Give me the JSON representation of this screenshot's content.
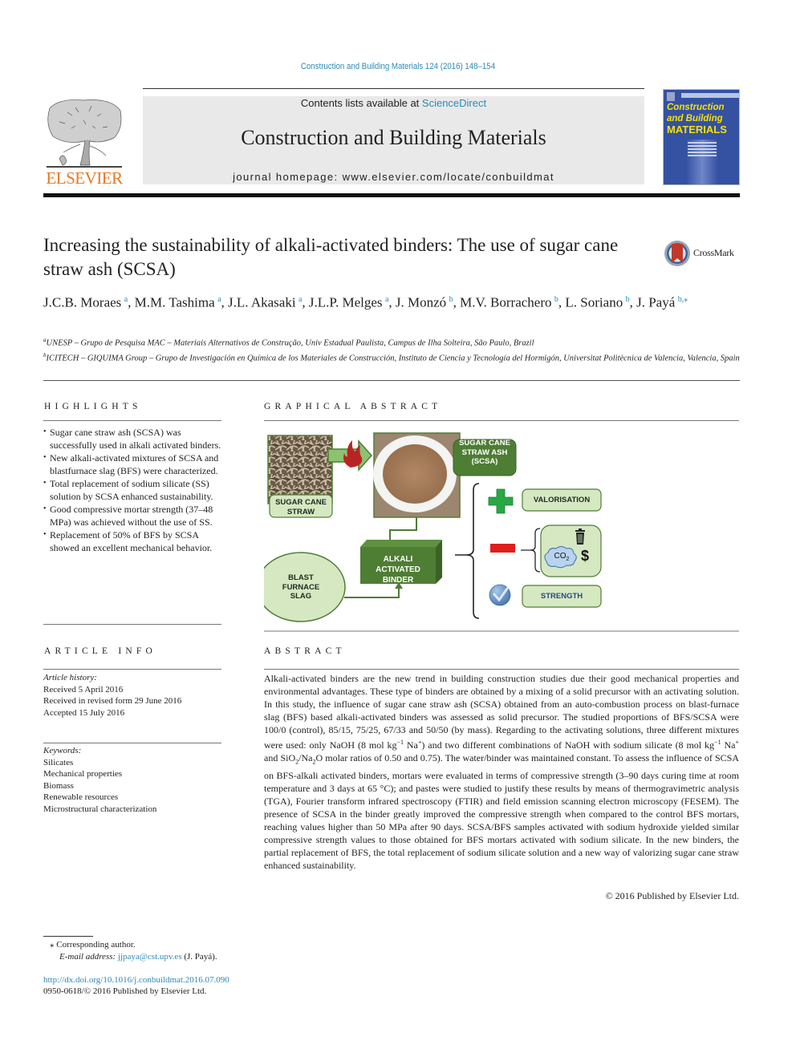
{
  "running_head": "Construction and Building Materials 124 (2016) 148–154",
  "masthead": {
    "publisher": "ELSEVIER",
    "contents_prefix": "Contents lists available at ",
    "contents_link": "ScienceDirect",
    "journal_title": "Construction and Building Materials",
    "homepage": "journal homepage: www.elsevier.com/locate/conbuildmat",
    "cover": {
      "line1": "Construction",
      "line2": "and Building",
      "line3": "MATERIALS",
      "colors": {
        "background": "#3451a2",
        "title": "#f5e10a"
      }
    }
  },
  "article": {
    "title": "Increasing the sustainability of alkali-activated binders: The use of sugar cane straw ash (SCSA)",
    "crossmark_label": "CrossMark",
    "authors": [
      {
        "name": "J.C.B. Moraes",
        "sup": "a",
        "sep": ", "
      },
      {
        "name": "M.M. Tashima",
        "sup": "a",
        "sep": ", "
      },
      {
        "name": "J.L. Akasaki",
        "sup": "a",
        "sep": ", "
      },
      {
        "name": "J.L.P. Melges",
        "sup": "a",
        "sep": ", "
      },
      {
        "name": "J. Monzó",
        "sup": "b",
        "sep": ", "
      },
      {
        "name": "M.V. Borrachero",
        "sup": "b",
        "sep": ", "
      },
      {
        "name": "L. Soriano",
        "sup": "b",
        "sep": ", "
      },
      {
        "name": "J. Payá",
        "sup": "b,⁎",
        "sep": ""
      }
    ],
    "affiliations": [
      {
        "mark": "a",
        "text": "UNESP – Grupo de Pesquisa MAC – Materiais Alternativos de Construção, Univ Estadual Paulista, Campus de Ilha Solteira, São Paulo, Brazil"
      },
      {
        "mark": "b",
        "text": "ICITECH – GIQUIMA Group – Grupo de Investigación en Química de los Materiales de Construcción, Instituto de Ciencia y Tecnología del Hormigón, Universitat Politècnica de Valencia, Valencia, Spain"
      }
    ]
  },
  "highlights": {
    "heading": "HIGHLIGHTS",
    "items": [
      "Sugar cane straw ash (SCSA) was successfully used in alkali activated binders.",
      "New alkali-activated mixtures of SCSA and blastfurnace slag (BFS) were characterized.",
      "Total replacement of sodium silicate (SS) solution by SCSA enhanced sustainability.",
      "Good compressive mortar strength (37–48 MPa) was achieved without the use of SS.",
      "Replacement of 50% of BFS by SCSA showed an excellent mechanical behavior."
    ]
  },
  "article_info": {
    "heading": "ARTICLE INFO",
    "history_label": "Article history:",
    "history": [
      "Received 5 April 2016",
      "Received in revised form 29 June 2016",
      "Accepted 15 July 2016"
    ],
    "keywords_label": "Keywords:",
    "keywords": [
      "Silicates",
      "Mechanical properties",
      "Biomass",
      "Renewable resources",
      "Microstructural characterization"
    ]
  },
  "graphical_abstract": {
    "heading": "GRAPHICAL ABSTRACT",
    "labels": {
      "straw": [
        "SUGAR CANE",
        "STRAW"
      ],
      "ash": [
        "SUGAR CANE",
        "STRAW ASH",
        "(SCSA)"
      ],
      "binder": [
        "ALKALI ACTIVATED",
        "BINDER"
      ],
      "slag": [
        "BLAST",
        "FURNACE",
        "SLAG"
      ],
      "valorisation": "VALORISATION",
      "co2": "CO",
      "co2_sub": "2",
      "dollar": "$",
      "strength": "STRENGTH"
    },
    "colors": {
      "dark_green": "#4e7d34",
      "light_green": "#d5e8c2",
      "plus_green": "#27a844",
      "minus_red": "#e01e1e",
      "check_blue": "#5a8bc4"
    }
  },
  "abstract": {
    "heading": "ABSTRACT",
    "p1": "Alkali-activated binders are the new trend in building construction studies due their good mechanical properties and environmental advantages. These type of binders are obtained by a mixing of a solid precursor with an activating solution. In this study, the influence of sugar cane straw ash (SCSA) obtained from an auto-combustion process on blast-furnace slag (BFS) based alkali-activated binders was assessed as solid precursor. The studied proportions of BFS/SCSA were 100/0 (control), 85/15, 75/25, 67/33 and 50/50 (by mass). Regarding to the activating solutions, three different mixtures were used: only NaOH (8 mol kg",
    "sup_neg1": "−1",
    "na1": " Na",
    "sup_plus": "+",
    "p2": ") and two different combinations of NaOH with sodium silicate (8 mol kg",
    "na2": " Na",
    "p3": " and SiO",
    "sub_2": "2",
    "p4": "/Na",
    "p5": "O molar ratios of 0.50 and 0.75). The water/binder was maintained constant. To assess the influence of SCSA on BFS-alkali activated binders, mortars were evaluated in terms of compressive strength (3–90 days curing time at room temperature and 3 days at 65 °C); and pastes were studied to justify these results by means of thermogravimetric analysis (TGA), Fourier transform infrared spectroscopy (FTIR) and field emission scanning electron microscopy (FESEM). The presence of SCSA in the binder greatly improved the compressive strength when compared to the control BFS mortars, reaching values higher than 50 MPa after 90 days. SCSA/BFS samples activated with sodium hydroxide yielded similar compressive strength values to those obtained for BFS mortars activated with sodium silicate. In the new binders, the partial replacement of BFS, the total replacement of sodium silicate solution and a new way of valorizing sugar cane straw enhanced sustainability.",
    "copyright": "© 2016 Published by Elsevier Ltd."
  },
  "footnotes": {
    "corresponding_mark": "⁎",
    "corresponding": " Corresponding author.",
    "email_label": "E-mail address: ",
    "email": "jjpaya@cst.upv.es",
    "email_suffix": " (J. Payá).",
    "doi": "http://dx.doi.org/10.1016/j.conbuildmat.2016.07.090",
    "issn": "0950-0618/© 2016 Published by Elsevier Ltd."
  }
}
